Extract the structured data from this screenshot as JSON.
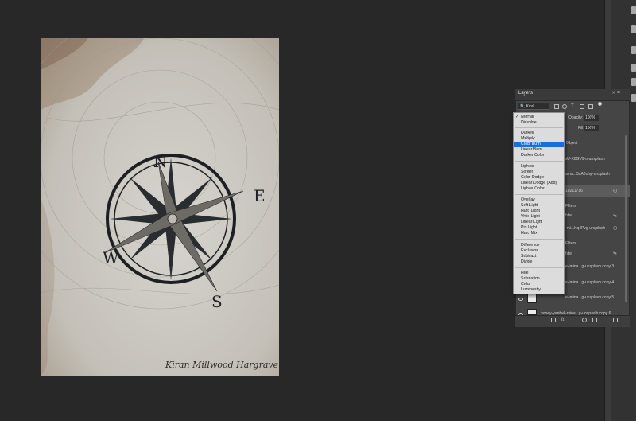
{
  "document": {
    "signature": "Kiran Millwood Hargrave",
    "compass_letters": {
      "n": "N",
      "e": "E",
      "s": "S",
      "w": "W"
    }
  },
  "layers_panel": {
    "title": "Layers",
    "kind_label": "Kind",
    "opacity_label": "Opacity:",
    "opacity_value": "100%",
    "fill_label": "Fill:",
    "fill_value": "100%",
    "rows": [
      {
        "text": "Object"
      },
      {
        "text": "mU-X0GV9-o-unsplash"
      },
      {
        "text": "ama...3qA8ohg-unsplash"
      },
      {
        "text": "19211716"
      },
      {
        "text": "Filters"
      },
      {
        "text": "hite"
      },
      {
        "text": "-mi...Kq4Pvg-unsplash"
      },
      {
        "text": "Filters"
      },
      {
        "text": "hite"
      },
      {
        "text": "ei-mina...g-unsplash copy 3"
      },
      {
        "text": "ei-mina...g-unsplash copy 4"
      },
      {
        "text": "ei-mina...g-unsplash copy 5"
      },
      {
        "text": "honey-yanibel-mina...g-unsplash copy 6"
      }
    ]
  },
  "blend_menu": {
    "items": [
      "Normal",
      "Dissolve",
      "Darken",
      "Multiply",
      "Color Burn",
      "Linear Burn",
      "Darker Color",
      "Lighten",
      "Screen",
      "Color Dodge",
      "Linear Dodge (Add)",
      "Lighter Color",
      "Overlay",
      "Soft Light",
      "Hard Light",
      "Vivid Light",
      "Linear Light",
      "Pin Light",
      "Hard Mix",
      "Difference",
      "Exclusion",
      "Subtract",
      "Divide",
      "Hue",
      "Saturation",
      "Color",
      "Luminosity"
    ],
    "checked": "Normal",
    "highlighted": "Color Burn"
  },
  "colors": {
    "menu_highlight": "#1a6ddd",
    "workspace": "#282828",
    "panel": "#454545"
  }
}
